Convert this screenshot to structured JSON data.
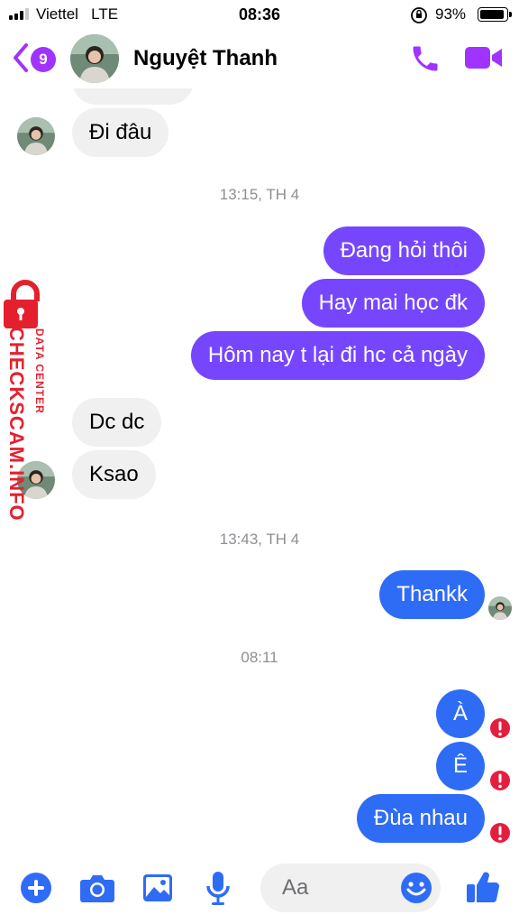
{
  "status_bar": {
    "carrier": "Viettel",
    "network": "LTE",
    "time": "08:36",
    "battery": "93%"
  },
  "header": {
    "unread_count": "9",
    "contact_name": "Nguyệt Thanh"
  },
  "messages": [
    {
      "sender": "them",
      "text": "Đi đâu"
    },
    {
      "type": "timestamp",
      "text": "13:15, TH 4"
    },
    {
      "sender": "me",
      "text": "Đang hỏi thôi"
    },
    {
      "sender": "me",
      "text": "Hay mai học đk"
    },
    {
      "sender": "me",
      "text": "Hôm nay t lại đi hc cả ngày"
    },
    {
      "sender": "them",
      "text": "Dc dc"
    },
    {
      "sender": "them",
      "text": "Ksao"
    },
    {
      "type": "timestamp",
      "text": "13:43, TH 4"
    },
    {
      "sender": "me",
      "text": "Thankk"
    },
    {
      "type": "timestamp",
      "text": "08:11"
    },
    {
      "sender": "me",
      "text": "À",
      "status": "failed"
    },
    {
      "sender": "me",
      "text": "Ê",
      "status": "failed"
    },
    {
      "sender": "me",
      "text": "Đùa nhau",
      "status": "failed"
    }
  ],
  "watermark": {
    "title": "CHECKSCAM.INFO",
    "subtitle": "DATA CENTER"
  },
  "composer": {
    "placeholder": "Aa"
  },
  "colors": {
    "accent": "#a033ff",
    "outgoing_old": "#7646ff",
    "outgoing_new": "#2f6cf6",
    "incoming": "#f0f0f0",
    "error": "#e41e3f",
    "watermark": "#e4202e"
  },
  "icons": [
    "back-chevron-icon",
    "phone-icon",
    "video-camera-icon",
    "plus-icon",
    "camera-icon",
    "photo-icon",
    "microphone-icon",
    "emoji-icon",
    "thumbs-up-icon",
    "error-icon"
  ]
}
